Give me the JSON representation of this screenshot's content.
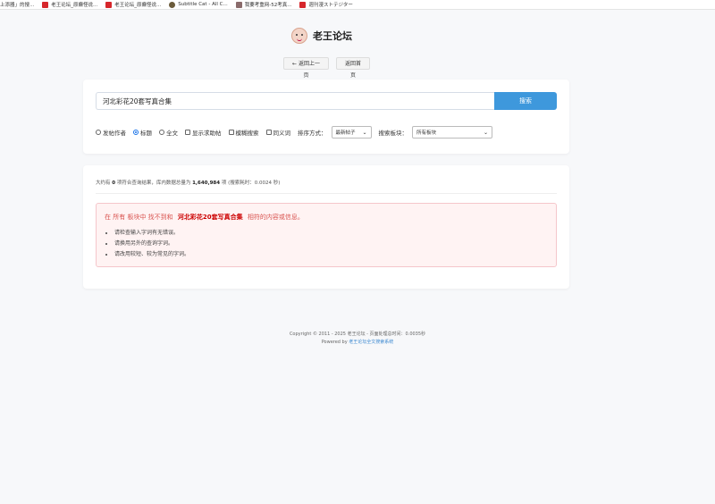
{
  "bookmarks": [
    {
      "label": "上添器」的搜...",
      "color": ""
    },
    {
      "label": "老王论坛_原癫怪说...",
      "color": "#d6262b"
    },
    {
      "label": "老王论坛_原癫怪说...",
      "color": "#d6262b"
    },
    {
      "label": "Subtitle Cat - All C...",
      "color": "#6b5b3a"
    },
    {
      "label": "我要考重网-52考真...",
      "color": "#8a6b6b"
    },
    {
      "label": "週刊漫ストテジター",
      "color": "#d6262b"
    }
  ],
  "header": {
    "site_name": "老王论坛",
    "back_label": "← 返回上一页",
    "home_label": "返回首页"
  },
  "search": {
    "query": "河北彩花20套写真合集",
    "button_label": "搜索",
    "options": {
      "author": "发帖作者",
      "title": "标题",
      "fulltext": "全文",
      "show_help": "显示求助帖",
      "fuzzy": "模糊搜索",
      "synonym": "同义词",
      "sort_label": "排序方式：",
      "sort_value": "最新帖子",
      "board_label": "搜索板块：",
      "board_value": "所有板块"
    },
    "selected_scope": "title"
  },
  "results": {
    "stats_prefix": "大约有",
    "count": "0",
    "stats_mid": "项符合查询结果，库内数据总量为",
    "total": "1,640,984",
    "stats_suffix": "项 (搜索耗时：0.0024 秒)",
    "notice_prefix": "在 所有 板块中 找不到和",
    "notice_query": "河北彩花20套写真合集",
    "notice_suffix": "相符的内容或信息。",
    "tips": [
      "请检查输入字词有无错误。",
      "请换用另外的查询字词。",
      "请改用较短、较为常见的字词。"
    ]
  },
  "footer": {
    "copyright": "Copyright © 2011 - 2025 老王论坛 - 页面处理总时间：0.0035秒",
    "powered_prefix": "Powered by",
    "powered_link": "老王论坛全文搜索系统"
  },
  "colors": {
    "accent": "#3e98dc",
    "notice_bg": "#fff3f3",
    "notice_text": "#d9534f"
  }
}
